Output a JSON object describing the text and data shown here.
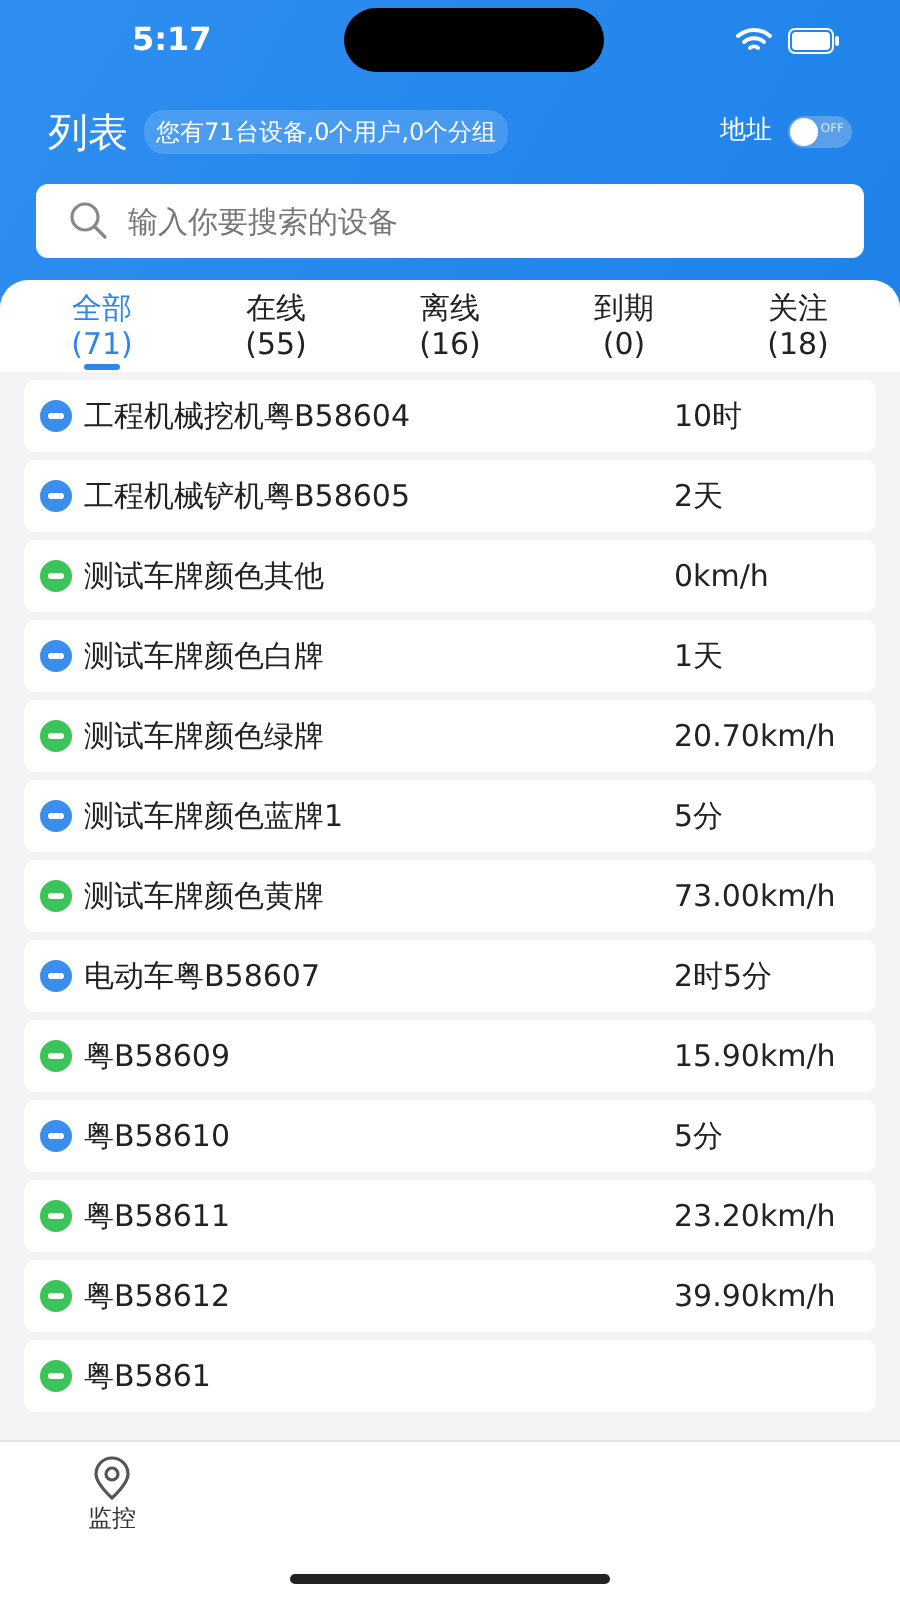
{
  "status_bar": {
    "time": "5:17"
  },
  "header": {
    "title": "列表",
    "summary": "您有71台设备,0个用户,0个分组",
    "address_label": "地址",
    "address_switch": {
      "on": false,
      "label": "OFF"
    }
  },
  "search": {
    "placeholder": "输入你要搜索的设备"
  },
  "tabs": [
    {
      "label": "全部",
      "count": "(71)",
      "selected": true
    },
    {
      "label": "在线",
      "count": "(55)",
      "selected": false
    },
    {
      "label": "离线",
      "count": "(16)",
      "selected": false
    },
    {
      "label": "到期",
      "count": "(0)",
      "selected": false
    },
    {
      "label": "关注",
      "count": "(18)",
      "selected": false
    }
  ],
  "devices": [
    {
      "name": "工程机械挖机粤B58604",
      "value": "10时",
      "color": "#3b8fe8"
    },
    {
      "name": "工程机械铲机粤B58605",
      "value": "2天",
      "color": "#3b8fe8"
    },
    {
      "name": "测试车牌颜色其他",
      "value": "0km/h",
      "color": "#3cc35a"
    },
    {
      "name": "测试车牌颜色白牌",
      "value": "1天",
      "color": "#3b8fe8"
    },
    {
      "name": "测试车牌颜色绿牌",
      "value": "20.70km/h",
      "color": "#3cc35a"
    },
    {
      "name": "测试车牌颜色蓝牌1",
      "value": "5分",
      "color": "#3b8fe8"
    },
    {
      "name": "测试车牌颜色黄牌",
      "value": "73.00km/h",
      "color": "#3cc35a"
    },
    {
      "name": "电动车粤B58607",
      "value": "2时5分",
      "color": "#3b8fe8"
    },
    {
      "name": "粤B58609",
      "value": "15.90km/h",
      "color": "#3cc35a"
    },
    {
      "name": "粤B58610",
      "value": "5分",
      "color": "#3b8fe8"
    },
    {
      "name": "粤B58611",
      "value": "23.20km/h",
      "color": "#3cc35a"
    },
    {
      "name": "粤B58612",
      "value": "39.90km/h",
      "color": "#3cc35a"
    },
    {
      "name": "粤B5861",
      "color": "#3cc35a"
    }
  ],
  "bottom_nav": [
    {
      "label": "监控",
      "selected": false
    }
  ]
}
